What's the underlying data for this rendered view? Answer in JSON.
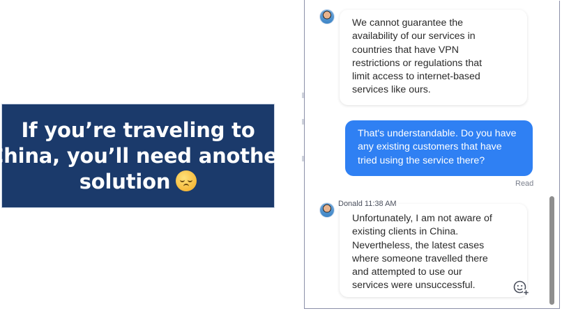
{
  "caption": {
    "lines": [
      "If you’re traveling to",
      "China, you’ll need another",
      "solution"
    ],
    "emoji_icon": "pensive-face-emoji"
  },
  "chat": {
    "messages": [
      {
        "direction": "incoming",
        "lines": [
          "We cannot guarantee the",
          "availability of our services in",
          "countries that have VPN",
          "restrictions or regulations that",
          "limit access to internet-based",
          "services like ours."
        ]
      },
      {
        "direction": "outgoing",
        "lines": [
          "That's understandable. Do you have",
          "any existing customers that have",
          "tried using the service there?"
        ],
        "status": "Read"
      },
      {
        "direction": "incoming",
        "sender": "Donald",
        "time": "11:38 AM",
        "lines": [
          "Unfortunately, I am not aware of",
          "existing clients in China.",
          "Nevertheless, the latest cases",
          "where someone travelled there",
          "and attempted to use our",
          "services were unsuccessful."
        ]
      }
    ],
    "reaction_icon": "add-reaction-icon"
  },
  "colors": {
    "caption_bg": "#1b3a6b",
    "outgoing_bubble": "#2f80f3",
    "incoming_bubble": "#ffffff"
  }
}
